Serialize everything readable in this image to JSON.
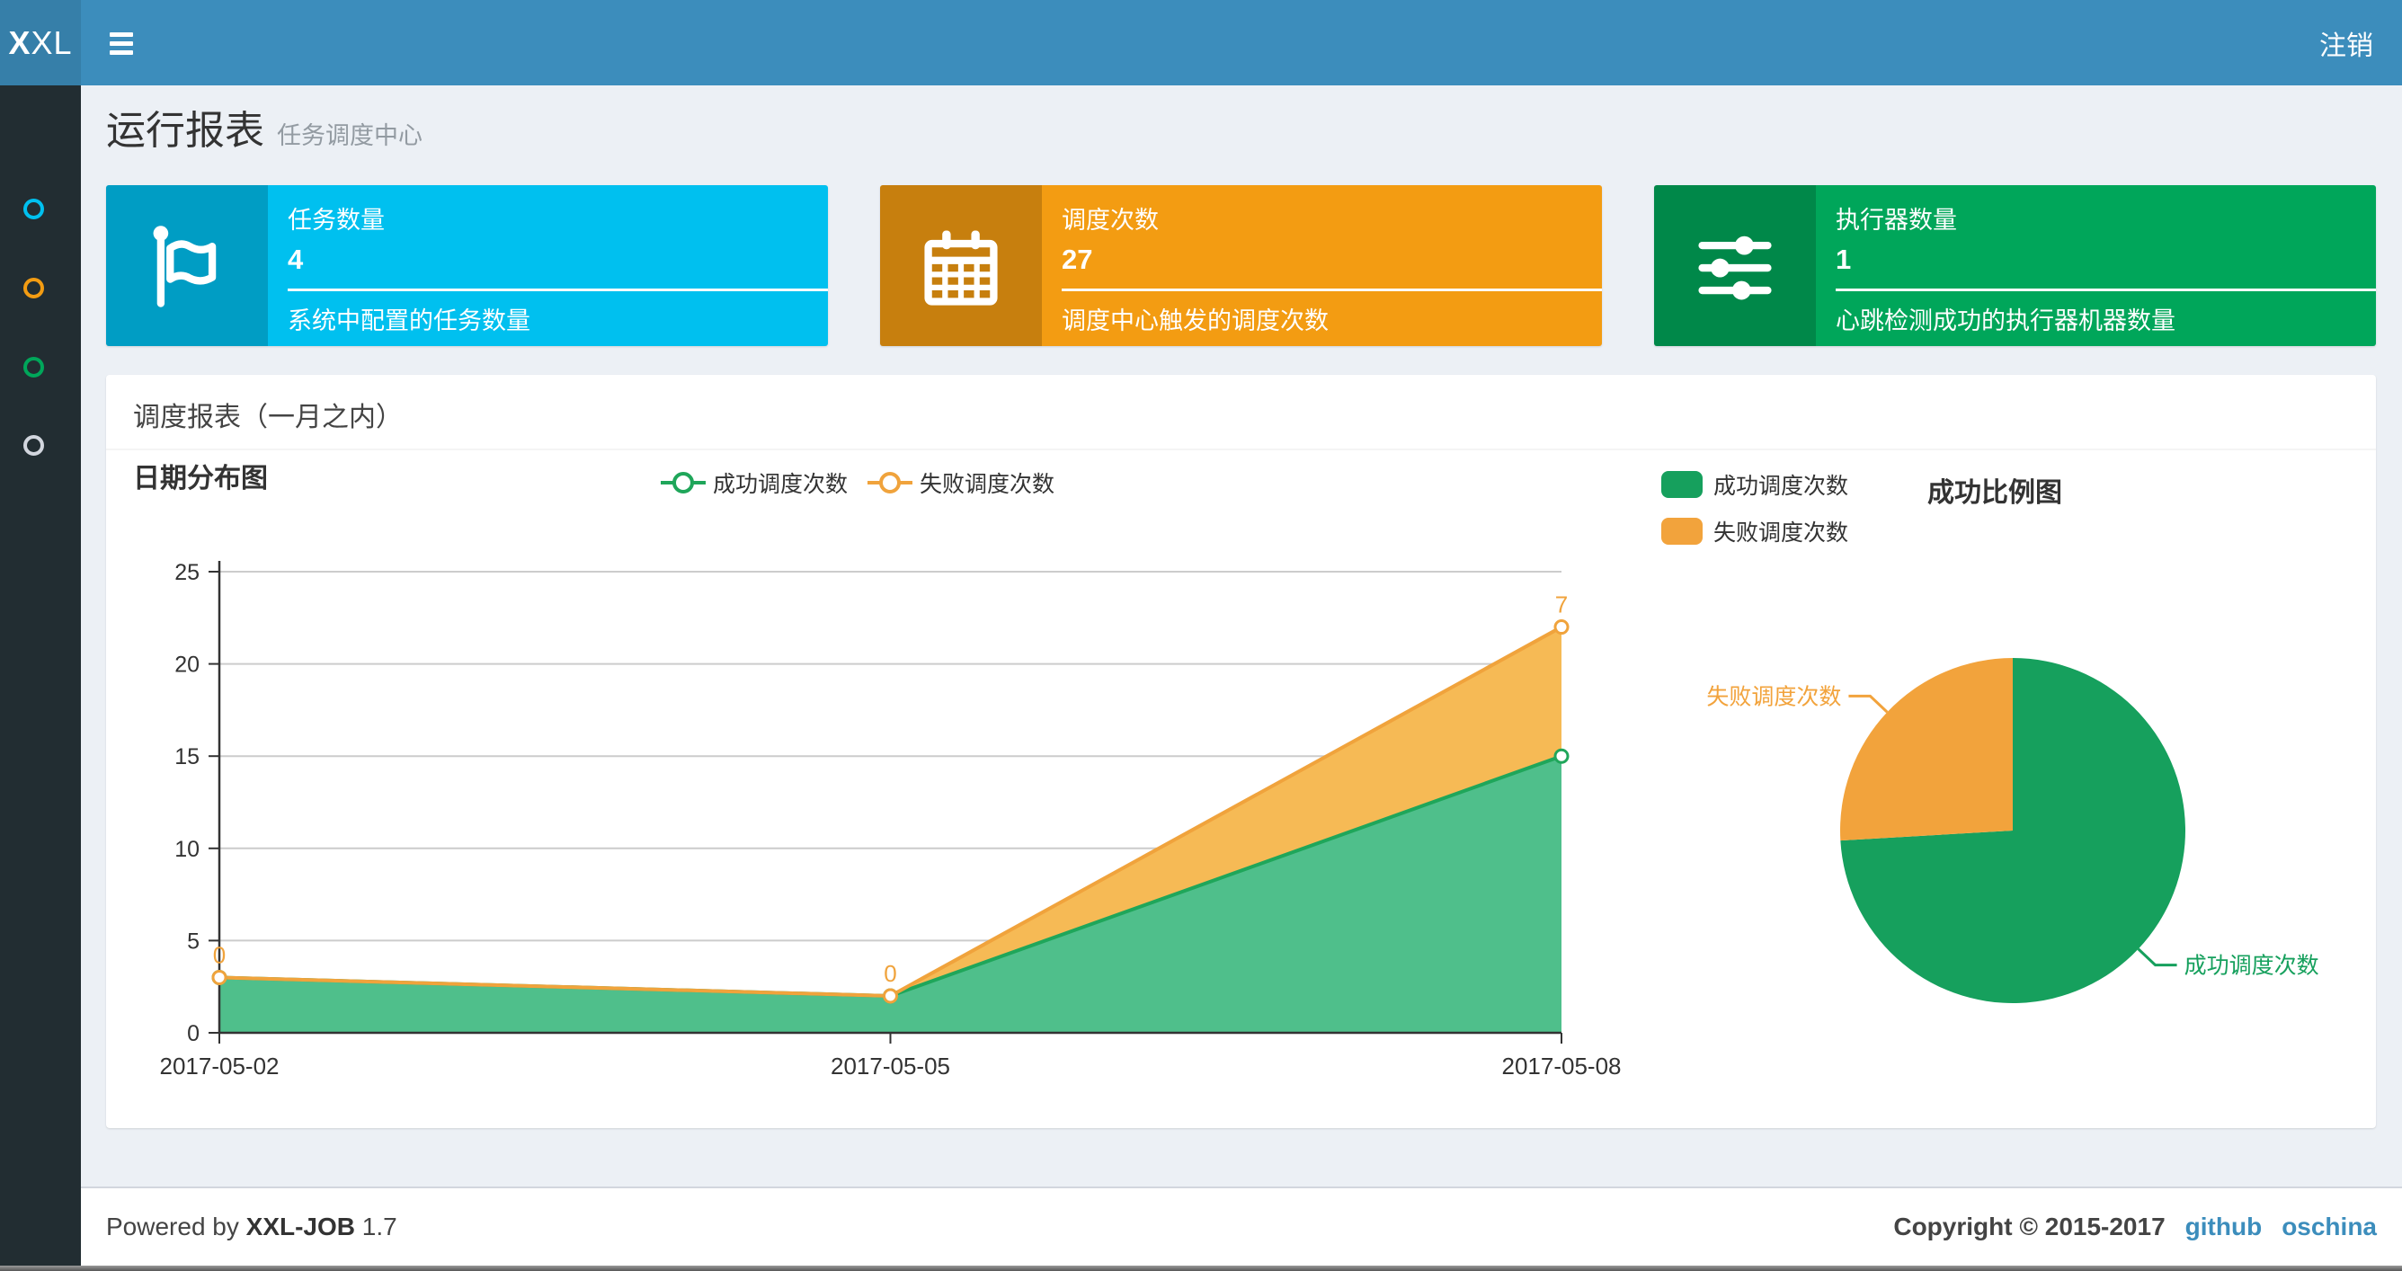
{
  "navbar": {
    "logo_bold": "X",
    "logo_rest": "XL",
    "logout": "注销"
  },
  "sidebar": {
    "items": [
      {
        "icon": "circle-outline-icon",
        "color": "#00c0ef"
      },
      {
        "icon": "circle-outline-icon",
        "color": "#f39c12"
      },
      {
        "icon": "circle-outline-icon",
        "color": "#00a65a"
      },
      {
        "icon": "circle-outline-icon",
        "color": "#d2d6de"
      }
    ]
  },
  "page": {
    "title": "运行报表",
    "subtitle": "任务调度中心"
  },
  "info_boxes": [
    {
      "icon": "flag-icon",
      "title": "任务数量",
      "value": "4",
      "description": "系统中配置的任务数量",
      "color": "#00c0ef"
    },
    {
      "icon": "calendar-icon",
      "title": "调度次数",
      "value": "27",
      "description": "调度中心触发的调度次数",
      "color": "#f39c12"
    },
    {
      "icon": "sliders-icon",
      "title": "执行器数量",
      "value": "1",
      "description": "心跳检测成功的执行器机器数量",
      "color": "#00a65a"
    }
  ],
  "panel": {
    "title": "调度报表（一月之内）"
  },
  "chart_data": [
    {
      "type": "area",
      "title": "日期分布图",
      "stacked": true,
      "categories": [
        "2017-05-02",
        "2017-05-05",
        "2017-05-08"
      ],
      "series": [
        {
          "name": "成功调度次数",
          "values": [
            3,
            2,
            15
          ],
          "color": "#1fa65a",
          "area_color": "#4fbf8b"
        },
        {
          "name": "失败调度次数",
          "values": [
            0,
            0,
            7
          ],
          "color": "#f0a33c",
          "area_color": "#f6ba55",
          "point_labels": [
            "0",
            "0",
            "7"
          ]
        }
      ],
      "xlabel": "",
      "ylabel": "",
      "ylim": [
        0,
        25
      ],
      "yticks": [
        0,
        5,
        10,
        15,
        20,
        25
      ],
      "grid": true,
      "legend_position": "top"
    },
    {
      "type": "pie",
      "title": "成功比例图",
      "slices": [
        {
          "label": "成功调度次数",
          "value": 20,
          "color": "#16a05d"
        },
        {
          "label": "失败调度次数",
          "value": 7,
          "color": "#f2a33c"
        }
      ],
      "legend_position": "top-left"
    }
  ],
  "footer": {
    "powered_prefix": "Powered by",
    "app_name": "XXL-JOB",
    "version": "1.7",
    "copyright": "Copyright © 2015-2017",
    "links": [
      "github",
      "oschina"
    ]
  },
  "colors": {
    "navbar": "#3c8dbc",
    "logo": "#367fa9",
    "sidebar": "#222d32",
    "content": "#ecf0f5",
    "footer_border": "#d2d6de",
    "text": "#333333",
    "link": "#3c8dbc",
    "strip": "#565656",
    "axis": "#333333",
    "gridline": "#cccccc"
  }
}
